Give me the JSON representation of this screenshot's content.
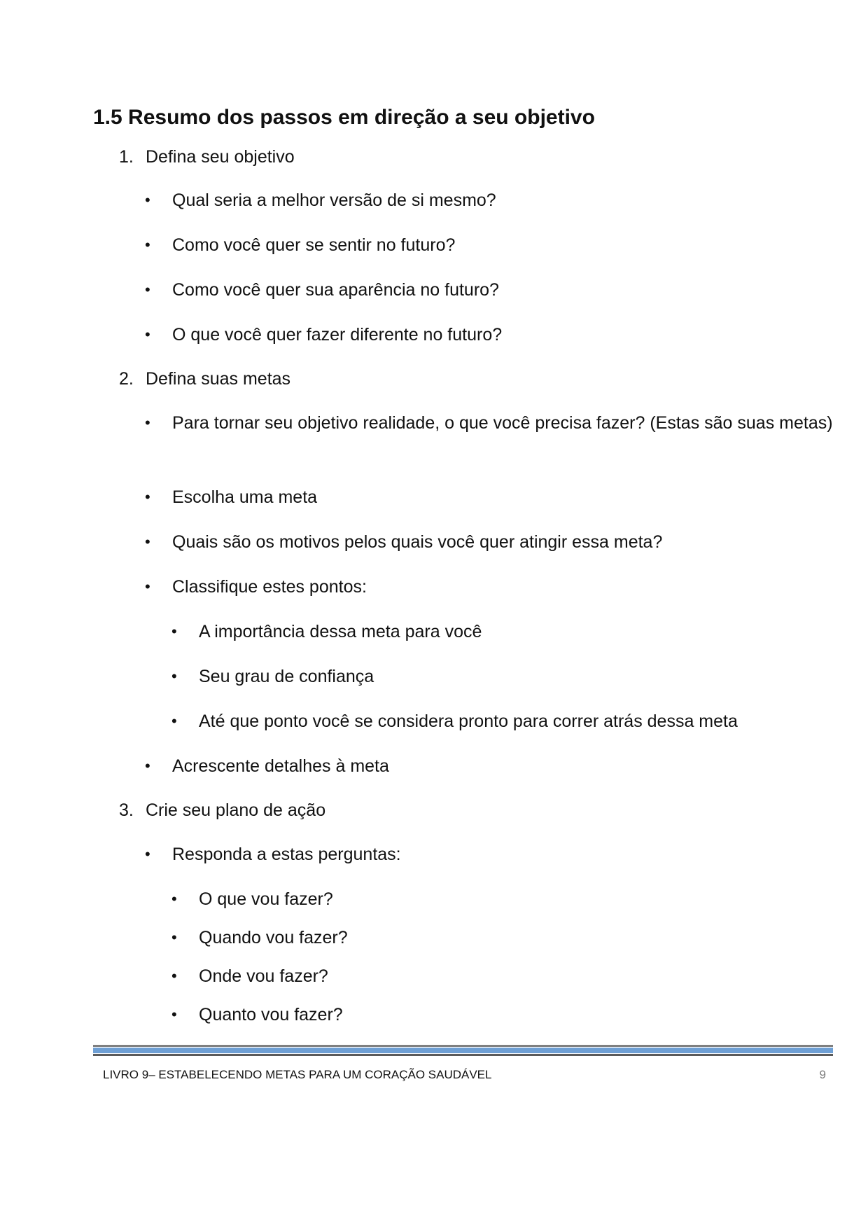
{
  "heading": "1.5 Resumo dos passos em direção a seu objetivo",
  "bullet_symbol": "•",
  "steps": [
    {
      "number": "1.",
      "label": "Defina seu objetivo",
      "items": [
        "Qual seria a melhor versão de si mesmo?",
        "Como você quer se sentir no futuro?",
        "Como você quer sua aparência no futuro?",
        "O que você quer fazer diferente no futuro?"
      ]
    },
    {
      "number": "2.",
      "label": "Defina suas metas",
      "items": [
        "Para tornar seu objetivo realidade, o que você precisa fazer? (Estas são suas metas)",
        "Escolha uma meta",
        "Quais são os motivos pelos quais você quer atingir essa meta?",
        "Classifique estes pontos:",
        "Acrescente detalhes à meta"
      ],
      "subitems": [
        "A importância dessa meta para você",
        "Seu grau de confiança",
        "Até que ponto você se considera pronto para correr atrás dessa meta"
      ]
    },
    {
      "number": "3.",
      "label": "Crie seu plano de ação",
      "items": [
        "Responda a estas perguntas:"
      ],
      "subitems": [
        "O que vou fazer?",
        "Quando vou fazer?",
        "Onde vou fazer?",
        "Quanto vou fazer?"
      ]
    }
  ],
  "footer": {
    "title": "LIVRO 9– ESTABELECENDO METAS PARA UM CORAÇÃO SAUDÁVEL",
    "page_number": "9"
  }
}
